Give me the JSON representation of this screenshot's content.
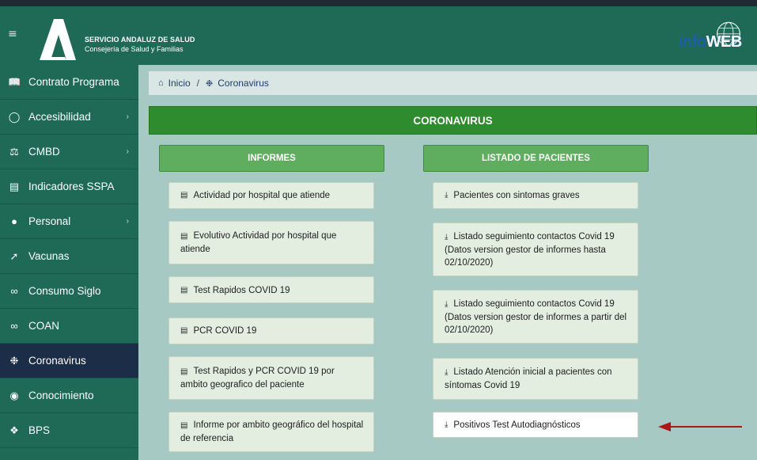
{
  "header": {
    "brand_line1": "SERVICIO ANDALUZ DE SALUD",
    "brand_line2": "Consejería de Salud y Familias",
    "logo_text_info": "info",
    "logo_text_web": "WEB"
  },
  "sidebar": {
    "items": [
      {
        "label": "Contrato Programa",
        "icon": "book-icon",
        "chevron": false
      },
      {
        "label": "Accesibilidad",
        "icon": "circle-check-icon",
        "chevron": true
      },
      {
        "label": "CMBD",
        "icon": "scale-icon",
        "chevron": true
      },
      {
        "label": "Indicadores SSPA",
        "icon": "bar-chart-icon",
        "chevron": false
      },
      {
        "label": "Personal",
        "icon": "user-icon",
        "chevron": true
      },
      {
        "label": "Vacunas",
        "icon": "syringe-icon",
        "chevron": false
      },
      {
        "label": "Consumo Siglo",
        "icon": "link-icon",
        "chevron": false
      },
      {
        "label": "COAN",
        "icon": "link-icon",
        "chevron": false
      },
      {
        "label": "Coronavirus",
        "icon": "virus-icon",
        "chevron": false,
        "active": true
      },
      {
        "label": "Conocimiento",
        "icon": "eye-icon",
        "chevron": false
      },
      {
        "label": "BPS",
        "icon": "dna-icon",
        "chevron": false
      }
    ],
    "chevron_glyph": "›"
  },
  "breadcrumb": {
    "home": "Inicio",
    "separator": "/",
    "current": "Coronavirus"
  },
  "page": {
    "title": "CORONAVIRUS"
  },
  "informes": {
    "heading": "INFORMES",
    "items": [
      "Actividad por hospital que atiende",
      "Evolutivo Actividad por hospital que atiende",
      "Test Rapidos COVID 19",
      "PCR COVID 19",
      "Test Rapidos y PCR COVID 19 por ambito geografico del paciente",
      "Informe por ambito geográfico del hospital de referencia"
    ]
  },
  "pacientes": {
    "heading": "LISTADO DE PACIENTES",
    "items": [
      "Pacientes con sintomas graves",
      "Listado seguimiento contactos Covid 19 (Datos version gestor de informes hasta 02/10/2020)",
      "Listado seguimiento contactos Covid 19 (Datos version gestor de informes a partir del 02/10/2020)",
      "Listado Atención inicial a pacientes con síntomas Covid 19",
      "Positivos Test Autodiagnósticos"
    ]
  },
  "colors": {
    "header_bg": "#1f6a57",
    "active_bg": "#1c2d48",
    "title_green": "#2e8b2e",
    "arrow_red": "#b01515"
  }
}
